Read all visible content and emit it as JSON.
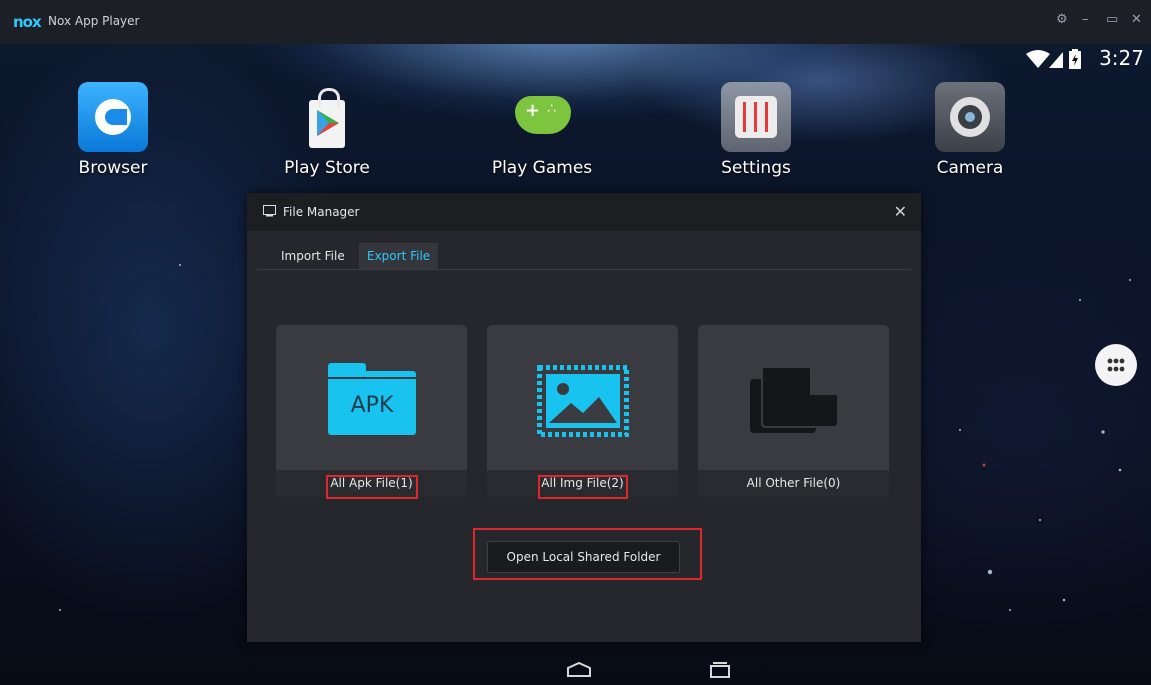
{
  "window": {
    "app_title": "Nox App Player",
    "logo_text": "nox"
  },
  "status_bar": {
    "time": "3:27"
  },
  "desktop_apps": [
    {
      "label": "Browser",
      "icon": "browser-icon"
    },
    {
      "label": "Play Store",
      "icon": "play-store-icon"
    },
    {
      "label": "Play Games",
      "icon": "play-games-icon"
    },
    {
      "label": "Settings",
      "icon": "settings-icon"
    },
    {
      "label": "Camera",
      "icon": "camera-icon"
    }
  ],
  "file_manager": {
    "title": "File Manager",
    "tabs": [
      {
        "label": "Import File",
        "active": false
      },
      {
        "label": "Export File",
        "active": true
      }
    ],
    "cards": [
      {
        "label": "All Apk File(1)",
        "icon": "apk-folder-icon",
        "icon_text": "APK",
        "highlighted": true
      },
      {
        "label": "All Img File(2)",
        "icon": "image-icon",
        "highlighted": true
      },
      {
        "label": "All Other File(0)",
        "icon": "other-files-icon",
        "highlighted": false
      }
    ],
    "open_button": "Open Local Shared Folder",
    "accent": "#2ec7ff",
    "highlight_color": "#e0262a"
  }
}
